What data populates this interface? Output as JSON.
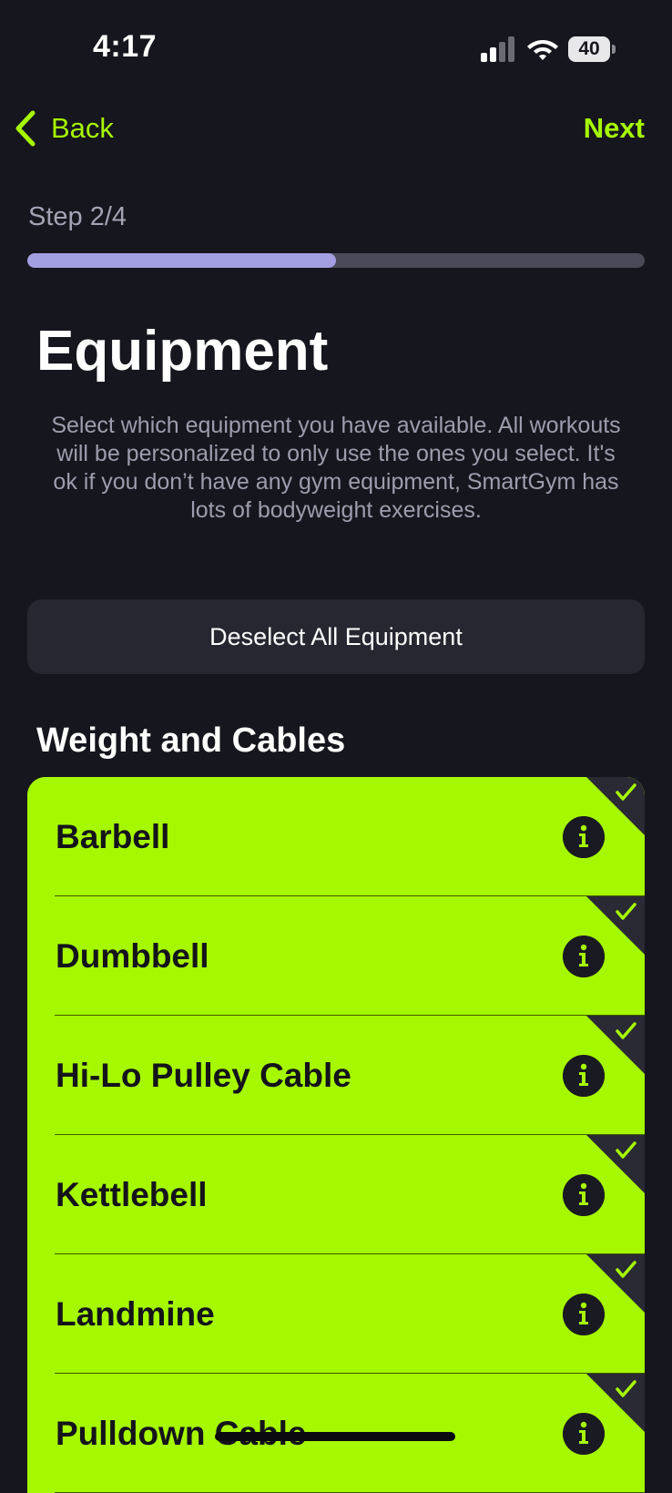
{
  "status_bar": {
    "time": "4:17",
    "battery": "40",
    "icons": [
      "signal-icon",
      "wifi-icon",
      "battery-icon"
    ]
  },
  "nav": {
    "back_label": "Back",
    "next_label": "Next",
    "icons": [
      "chevron-left-icon"
    ]
  },
  "step": {
    "label": "Step 2/4",
    "progress": 0.5
  },
  "page": {
    "title": "Equipment",
    "description": "Select which equipment you have available. All workouts will be personalized to only use the ones you select. It's ok if you don’t have any gym equipment, SmartGym has lots of bodyweight exercises.",
    "deselect_label": "Deselect All Equipment"
  },
  "section": {
    "title": "Weight and Cables",
    "items": [
      {
        "label": "Barbell",
        "selected": true
      },
      {
        "label": "Dumbbell",
        "selected": true
      },
      {
        "label": "Hi-Lo Pulley Cable",
        "selected": true
      },
      {
        "label": "Kettlebell",
        "selected": true
      },
      {
        "label": "Landmine",
        "selected": true
      },
      {
        "label": "Pulldown Cable",
        "selected": true
      }
    ]
  },
  "colors": {
    "background": "#16161e",
    "accent": "#a6f800",
    "progress_fill": "#a39fe3",
    "progress_track": "#4a4a58",
    "button_bg": "#272731"
  }
}
